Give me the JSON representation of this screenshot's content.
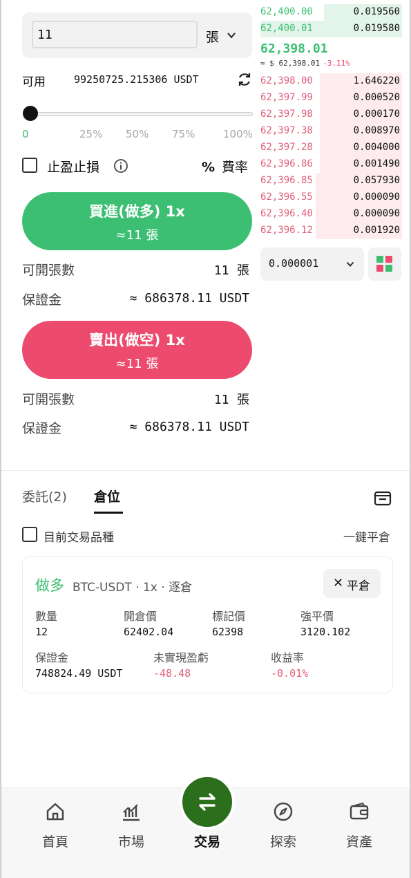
{
  "order_form": {
    "quantity_value": "11",
    "quantity_unit": "張",
    "available_label": "可用",
    "available_value": "99250725.215306 USDT",
    "slider_marks": [
      "0",
      "25%",
      "50%",
      "75%",
      "100%"
    ],
    "slider_level_percent": 0,
    "tpsl_label": "止盈止損",
    "fee_symbol": "%",
    "fee_label": "費率",
    "buy": {
      "title": "買進(做多) 1x",
      "subtitle": "≈11 張",
      "openable_label": "可開張數",
      "openable_value": "11",
      "openable_unit": "張",
      "margin_label": "保證金",
      "margin_value": "≈ 686378.11 USDT"
    },
    "sell": {
      "title": "賣出(做空) 1x",
      "subtitle": "≈11 張",
      "openable_label": "可開張數",
      "openable_value": "11",
      "openable_unit": "張",
      "margin_label": "保證金",
      "margin_value": "≈ 686378.11 USDT"
    }
  },
  "order_book": {
    "bids_top": [
      {
        "price": "62,400.00",
        "size": "0.019560",
        "depth": 0.55
      },
      {
        "price": "62,400.01",
        "size": "0.019580",
        "depth": 1.0
      }
    ],
    "mid_price": "62,398.01",
    "mid_sub": "≈ $ 62,398.01",
    "mid_change": "-3.11%",
    "asks": [
      {
        "price": "62,398.00",
        "size": "1.646220",
        "depth": 0.58
      },
      {
        "price": "62,397.99",
        "size": "0.000520",
        "depth": 0.58
      },
      {
        "price": "62,397.98",
        "size": "0.000170",
        "depth": 0.58
      },
      {
        "price": "62,397.38",
        "size": "0.008970",
        "depth": 0.58
      },
      {
        "price": "62,397.28",
        "size": "0.004000",
        "depth": 0.58
      },
      {
        "price": "62,396.86",
        "size": "0.001490",
        "depth": 0.58
      },
      {
        "price": "62,396.85",
        "size": "0.057930",
        "depth": 0.61
      },
      {
        "price": "62,396.55",
        "size": "0.000090",
        "depth": 0.61
      },
      {
        "price": "62,396.40",
        "size": "0.000090",
        "depth": 0.61
      },
      {
        "price": "62,396.12",
        "size": "0.001920",
        "depth": 0.61
      }
    ],
    "precision_value": "0.000001"
  },
  "tabs": {
    "orders": "委託(2)",
    "positions": "倉位"
  },
  "filters": {
    "current_symbol_label": "目前交易品種",
    "close_all_label": "一鍵平倉"
  },
  "position": {
    "side": "做多",
    "symbol": "BTC-USDT · 1x · 逐倉",
    "close_label": "平倉",
    "fields": [
      {
        "label": "數量",
        "value": "12",
        "tone": "normal"
      },
      {
        "label": "開倉價",
        "value": "62402.04",
        "tone": "normal"
      },
      {
        "label": "標記價",
        "value": "62398",
        "tone": "normal"
      },
      {
        "label": "強平價",
        "value": "3120.102",
        "tone": "normal"
      },
      {
        "label": "保證金",
        "value": "748824.49 USDT",
        "tone": "normal"
      },
      {
        "label": "未實現盈虧",
        "value": "-48.48",
        "tone": "red"
      },
      {
        "label": "收益率",
        "value": "-0.01%",
        "tone": "red"
      }
    ]
  },
  "nav": {
    "home": "首頁",
    "market": "市場",
    "trade": "交易",
    "explore": "探索",
    "assets": "資產"
  },
  "colors": {
    "buy_green": "#3cbf73",
    "sell_red": "#ec4b6e",
    "trade_nav_green": "#2b6e1c"
  }
}
